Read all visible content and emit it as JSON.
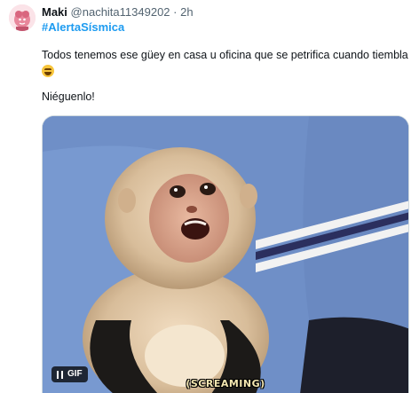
{
  "tweet": {
    "display_name": "Maki",
    "handle": "@nachita11349202",
    "separator": "·",
    "time": "2h",
    "hashtag": "#AlertaSísmica",
    "text_line1": "Todos tenemos ese güey en casa u oficina  que se petrifica cuando tiembla",
    "text_line2": "Niéguenlo!",
    "emoji_name": "rolling-on-floor-laughing-emoji"
  },
  "media": {
    "gif_label": "GIF",
    "caption": "(SCREAMING)",
    "pause_icon": "pause-icon"
  },
  "colors": {
    "link": "#1d9bf0",
    "muted": "#536471",
    "text": "#0f1419"
  }
}
